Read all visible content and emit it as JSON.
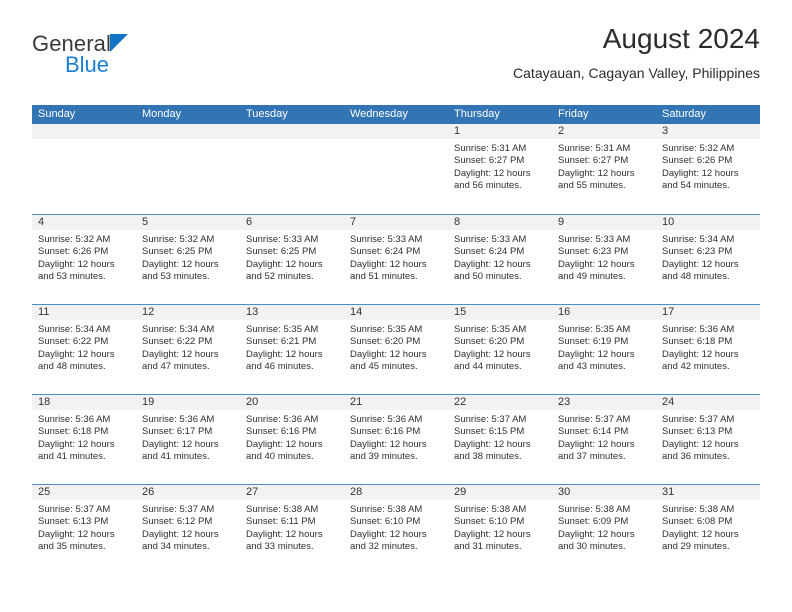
{
  "logo": {
    "word_one": "General",
    "word_two": "Blue",
    "triangle_color": "#1274c2",
    "blue_text_color": "#1b7fd4"
  },
  "header": {
    "title": "August 2024",
    "subtitle": "Catayauan, Cagayan Valley, Philippines",
    "header_bg_color": "#3274b4",
    "header_text_color": "#ffffff",
    "day_band_color": "#f2f2f2",
    "week_divider_color": "#4a8fcb"
  },
  "weekday_headers": [
    "Sunday",
    "Monday",
    "Tuesday",
    "Wednesday",
    "Thursday",
    "Friday",
    "Saturday"
  ],
  "weeks": [
    [
      {
        "num": "",
        "sunrise": "",
        "sunset": "",
        "daylight1": "",
        "daylight2": "",
        "empty": true
      },
      {
        "num": "",
        "sunrise": "",
        "sunset": "",
        "daylight1": "",
        "daylight2": "",
        "empty": true
      },
      {
        "num": "",
        "sunrise": "",
        "sunset": "",
        "daylight1": "",
        "daylight2": "",
        "empty": true
      },
      {
        "num": "",
        "sunrise": "",
        "sunset": "",
        "daylight1": "",
        "daylight2": "",
        "empty": true
      },
      {
        "num": "1",
        "sunrise": "Sunrise: 5:31 AM",
        "sunset": "Sunset: 6:27 PM",
        "daylight1": "Daylight: 12 hours",
        "daylight2": "and 56 minutes."
      },
      {
        "num": "2",
        "sunrise": "Sunrise: 5:31 AM",
        "sunset": "Sunset: 6:27 PM",
        "daylight1": "Daylight: 12 hours",
        "daylight2": "and 55 minutes."
      },
      {
        "num": "3",
        "sunrise": "Sunrise: 5:32 AM",
        "sunset": "Sunset: 6:26 PM",
        "daylight1": "Daylight: 12 hours",
        "daylight2": "and 54 minutes."
      }
    ],
    [
      {
        "num": "4",
        "sunrise": "Sunrise: 5:32 AM",
        "sunset": "Sunset: 6:26 PM",
        "daylight1": "Daylight: 12 hours",
        "daylight2": "and 53 minutes."
      },
      {
        "num": "5",
        "sunrise": "Sunrise: 5:32 AM",
        "sunset": "Sunset: 6:25 PM",
        "daylight1": "Daylight: 12 hours",
        "daylight2": "and 53 minutes."
      },
      {
        "num": "6",
        "sunrise": "Sunrise: 5:33 AM",
        "sunset": "Sunset: 6:25 PM",
        "daylight1": "Daylight: 12 hours",
        "daylight2": "and 52 minutes."
      },
      {
        "num": "7",
        "sunrise": "Sunrise: 5:33 AM",
        "sunset": "Sunset: 6:24 PM",
        "daylight1": "Daylight: 12 hours",
        "daylight2": "and 51 minutes."
      },
      {
        "num": "8",
        "sunrise": "Sunrise: 5:33 AM",
        "sunset": "Sunset: 6:24 PM",
        "daylight1": "Daylight: 12 hours",
        "daylight2": "and 50 minutes."
      },
      {
        "num": "9",
        "sunrise": "Sunrise: 5:33 AM",
        "sunset": "Sunset: 6:23 PM",
        "daylight1": "Daylight: 12 hours",
        "daylight2": "and 49 minutes."
      },
      {
        "num": "10",
        "sunrise": "Sunrise: 5:34 AM",
        "sunset": "Sunset: 6:23 PM",
        "daylight1": "Daylight: 12 hours",
        "daylight2": "and 48 minutes."
      }
    ],
    [
      {
        "num": "11",
        "sunrise": "Sunrise: 5:34 AM",
        "sunset": "Sunset: 6:22 PM",
        "daylight1": "Daylight: 12 hours",
        "daylight2": "and 48 minutes."
      },
      {
        "num": "12",
        "sunrise": "Sunrise: 5:34 AM",
        "sunset": "Sunset: 6:22 PM",
        "daylight1": "Daylight: 12 hours",
        "daylight2": "and 47 minutes."
      },
      {
        "num": "13",
        "sunrise": "Sunrise: 5:35 AM",
        "sunset": "Sunset: 6:21 PM",
        "daylight1": "Daylight: 12 hours",
        "daylight2": "and 46 minutes."
      },
      {
        "num": "14",
        "sunrise": "Sunrise: 5:35 AM",
        "sunset": "Sunset: 6:20 PM",
        "daylight1": "Daylight: 12 hours",
        "daylight2": "and 45 minutes."
      },
      {
        "num": "15",
        "sunrise": "Sunrise: 5:35 AM",
        "sunset": "Sunset: 6:20 PM",
        "daylight1": "Daylight: 12 hours",
        "daylight2": "and 44 minutes."
      },
      {
        "num": "16",
        "sunrise": "Sunrise: 5:35 AM",
        "sunset": "Sunset: 6:19 PM",
        "daylight1": "Daylight: 12 hours",
        "daylight2": "and 43 minutes."
      },
      {
        "num": "17",
        "sunrise": "Sunrise: 5:36 AM",
        "sunset": "Sunset: 6:18 PM",
        "daylight1": "Daylight: 12 hours",
        "daylight2": "and 42 minutes."
      }
    ],
    [
      {
        "num": "18",
        "sunrise": "Sunrise: 5:36 AM",
        "sunset": "Sunset: 6:18 PM",
        "daylight1": "Daylight: 12 hours",
        "daylight2": "and 41 minutes."
      },
      {
        "num": "19",
        "sunrise": "Sunrise: 5:36 AM",
        "sunset": "Sunset: 6:17 PM",
        "daylight1": "Daylight: 12 hours",
        "daylight2": "and 41 minutes."
      },
      {
        "num": "20",
        "sunrise": "Sunrise: 5:36 AM",
        "sunset": "Sunset: 6:16 PM",
        "daylight1": "Daylight: 12 hours",
        "daylight2": "and 40 minutes."
      },
      {
        "num": "21",
        "sunrise": "Sunrise: 5:36 AM",
        "sunset": "Sunset: 6:16 PM",
        "daylight1": "Daylight: 12 hours",
        "daylight2": "and 39 minutes."
      },
      {
        "num": "22",
        "sunrise": "Sunrise: 5:37 AM",
        "sunset": "Sunset: 6:15 PM",
        "daylight1": "Daylight: 12 hours",
        "daylight2": "and 38 minutes."
      },
      {
        "num": "23",
        "sunrise": "Sunrise: 5:37 AM",
        "sunset": "Sunset: 6:14 PM",
        "daylight1": "Daylight: 12 hours",
        "daylight2": "and 37 minutes."
      },
      {
        "num": "24",
        "sunrise": "Sunrise: 5:37 AM",
        "sunset": "Sunset: 6:13 PM",
        "daylight1": "Daylight: 12 hours",
        "daylight2": "and 36 minutes."
      }
    ],
    [
      {
        "num": "25",
        "sunrise": "Sunrise: 5:37 AM",
        "sunset": "Sunset: 6:13 PM",
        "daylight1": "Daylight: 12 hours",
        "daylight2": "and 35 minutes."
      },
      {
        "num": "26",
        "sunrise": "Sunrise: 5:37 AM",
        "sunset": "Sunset: 6:12 PM",
        "daylight1": "Daylight: 12 hours",
        "daylight2": "and 34 minutes."
      },
      {
        "num": "27",
        "sunrise": "Sunrise: 5:38 AM",
        "sunset": "Sunset: 6:11 PM",
        "daylight1": "Daylight: 12 hours",
        "daylight2": "and 33 minutes."
      },
      {
        "num": "28",
        "sunrise": "Sunrise: 5:38 AM",
        "sunset": "Sunset: 6:10 PM",
        "daylight1": "Daylight: 12 hours",
        "daylight2": "and 32 minutes."
      },
      {
        "num": "29",
        "sunrise": "Sunrise: 5:38 AM",
        "sunset": "Sunset: 6:10 PM",
        "daylight1": "Daylight: 12 hours",
        "daylight2": "and 31 minutes."
      },
      {
        "num": "30",
        "sunrise": "Sunrise: 5:38 AM",
        "sunset": "Sunset: 6:09 PM",
        "daylight1": "Daylight: 12 hours",
        "daylight2": "and 30 minutes."
      },
      {
        "num": "31",
        "sunrise": "Sunrise: 5:38 AM",
        "sunset": "Sunset: 6:08 PM",
        "daylight1": "Daylight: 12 hours",
        "daylight2": "and 29 minutes."
      }
    ]
  ]
}
